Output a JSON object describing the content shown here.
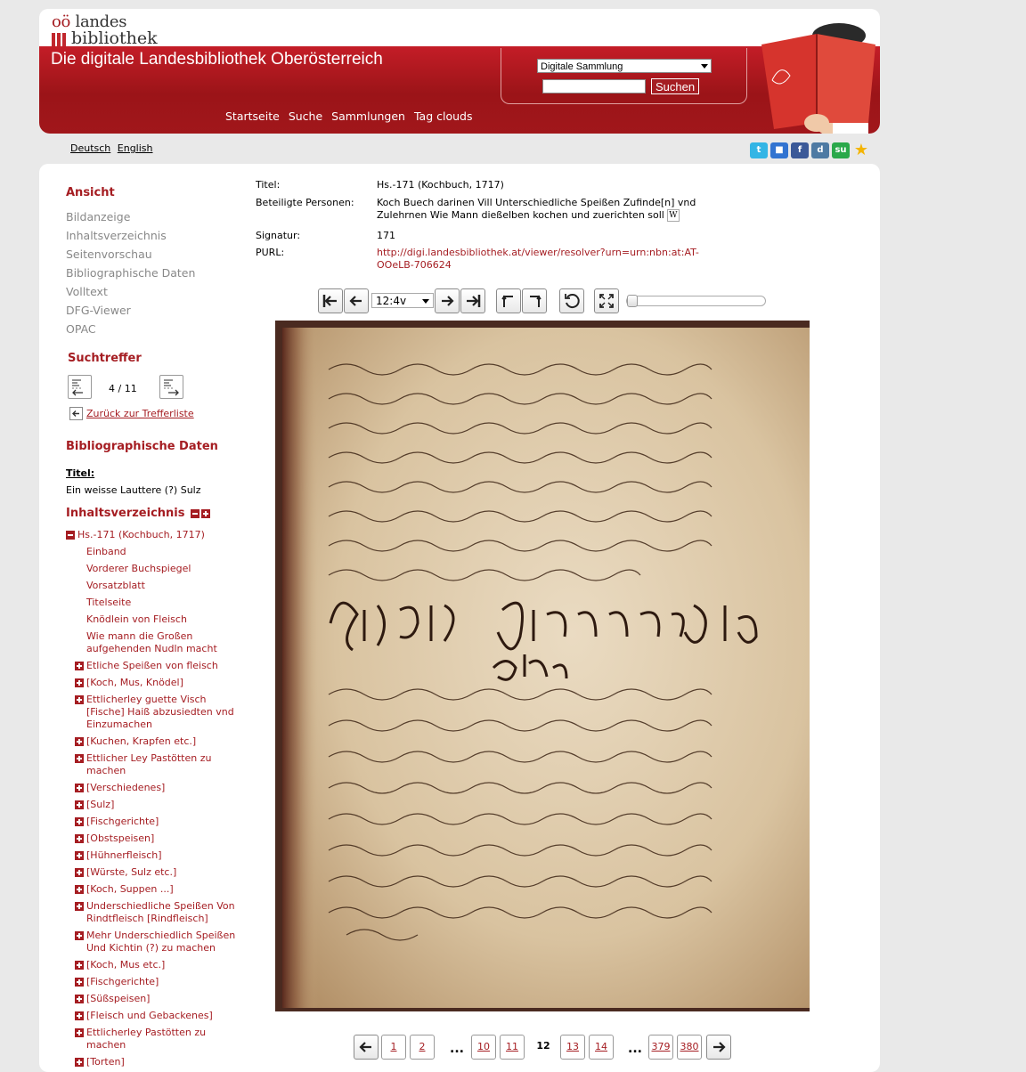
{
  "logo": {
    "line1_prefix": "oö",
    "line1": "landes",
    "line2": "bibliothek"
  },
  "banner": {
    "title": "Die digitale Landesbibliothek Oberösterreich"
  },
  "search": {
    "collection": "Digitale Sammlung",
    "button": "Suchen"
  },
  "topnav": [
    "Startseite",
    "Suche",
    "Sammlungen",
    "Tag clouds"
  ],
  "lang": [
    "Deutsch",
    "English"
  ],
  "social": [
    {
      "name": "twitter-icon",
      "glyph": "t",
      "color": "#33b5e5"
    },
    {
      "name": "delicious-icon",
      "glyph": "■",
      "color": "#3274d1"
    },
    {
      "name": "facebook-icon",
      "glyph": "f",
      "color": "#3b5998"
    },
    {
      "name": "digg-icon",
      "glyph": "d",
      "color": "#4e7aa3"
    },
    {
      "name": "stumbleupon-icon",
      "glyph": "su",
      "color": "#2aa84a"
    },
    {
      "name": "favorite-star-icon",
      "glyph": "★",
      "color": "#f4b400"
    }
  ],
  "sidebar": {
    "ansicht_heading": "Ansicht",
    "ansicht_links": [
      "Bildanzeige",
      "Inhaltsverzeichnis",
      "Seitenvorschau",
      "Bibliographische Daten",
      "Volltext",
      "DFG-Viewer",
      "OPAC"
    ],
    "hits_heading": "Suchtreffer",
    "hits_count": "4 / 11",
    "back_link": "Zurück zur Trefferliste",
    "bib_heading": "Bibliographische Daten",
    "bib_title_label": "Titel:",
    "bib_title_value": "Ein weisse Lauttere (?) Sulz",
    "toc_heading": "Inhaltsverzeichnis",
    "toc_root": "Hs.-171 (Kochbuch, 1717)",
    "toc_items": [
      {
        "label": "Einband",
        "expand": false
      },
      {
        "label": "Vorderer Buchspiegel",
        "expand": false
      },
      {
        "label": "Vorsatzblatt",
        "expand": false
      },
      {
        "label": "Titelseite",
        "expand": false
      },
      {
        "label": "Knödlein von Fleisch",
        "expand": false
      },
      {
        "label": "Wie mann die Großen aufgehenden Nudln macht",
        "expand": false
      },
      {
        "label": "Etliche Speißen von fleisch",
        "expand": true
      },
      {
        "label": "[Koch, Mus, Knödel]",
        "expand": true
      },
      {
        "label": "Ettlicherley guette Visch [Fische] Haiß abzusiedten vnd Einzumachen",
        "expand": true
      },
      {
        "label": "[Kuchen, Krapfen etc.]",
        "expand": true
      },
      {
        "label": "Ettlicher Ley Pastötten zu machen",
        "expand": true
      },
      {
        "label": "[Verschiedenes]",
        "expand": true
      },
      {
        "label": "[Sulz]",
        "expand": true
      },
      {
        "label": "[Fischgerichte]",
        "expand": true
      },
      {
        "label": "[Obstspeisen]",
        "expand": true
      },
      {
        "label": "[Hühnerfleisch]",
        "expand": true
      },
      {
        "label": "[Würste, Sulz etc.]",
        "expand": true
      },
      {
        "label": "[Koch, Suppen ...]",
        "expand": true
      },
      {
        "label": "Underschiedliche Speißen Von Rindtfleisch [Rindfleisch]",
        "expand": true
      },
      {
        "label": "Mehr Underschiedlich Speißen Und Kichtin (?) zu machen",
        "expand": true
      },
      {
        "label": "[Koch, Mus etc.]",
        "expand": true
      },
      {
        "label": "[Fischgerichte]",
        "expand": true
      },
      {
        "label": "[Süßspeisen]",
        "expand": true
      },
      {
        "label": "[Fleisch und Gebackenes]",
        "expand": true
      },
      {
        "label": "Ettlicherley Pastötten zu machen",
        "expand": true
      },
      {
        "label": "[Torten]",
        "expand": true
      }
    ]
  },
  "meta": {
    "title_label": "Titel:",
    "title_value": "Hs.-171 (Kochbuch, 1717)",
    "persons_label": "Beteiligte Personen:",
    "persons_line1": "Koch Buech darinen Vill Unterschiedliche Speißen Zufinde[n] vnd",
    "persons_line2": "Zulehrnen Wie Mann dießelben kochen und zuerichten soll",
    "signatur_label": "Signatur:",
    "signatur_value": "171",
    "purl_label": "PURL:",
    "purl_line1": "http://digi.landesbibliothek.at/viewer/resolver?urn=urn:nbn:at:AT-",
    "purl_line2": "OOeLB-706624"
  },
  "viewer": {
    "page_select": "12:4v"
  },
  "pagination": {
    "pages": [
      "1",
      "2",
      "10",
      "11",
      "12",
      "13",
      "14",
      "379",
      "380"
    ],
    "current": "12",
    "ellipsis": "..."
  }
}
